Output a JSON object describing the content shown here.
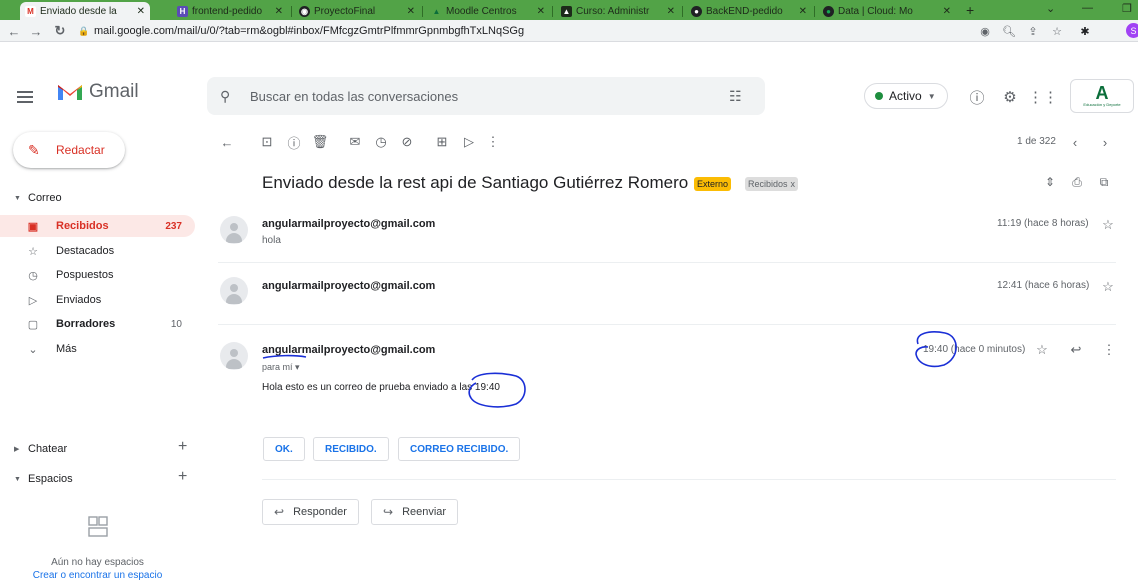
{
  "browser": {
    "tabs": [
      {
        "label": "Enviado desde la",
        "fav": "M",
        "favcolor": "#d93025",
        "favbg": "#ffffff",
        "active": true
      },
      {
        "label": "frontend-pedido",
        "fav": "H",
        "favcolor": "#ffffff",
        "favbg": "#5b4bb7",
        "active": false
      },
      {
        "label": "ProyectoFinal",
        "fav": "◉",
        "favcolor": "#ffffff",
        "favbg": "#202124",
        "active": false
      },
      {
        "label": "Moodle Centros",
        "fav": "▲",
        "favcolor": "#0b6e3a",
        "favbg": "#52a347",
        "active": false
      },
      {
        "label": "Curso: Administr",
        "fav": "▲",
        "favcolor": "#ffffff",
        "favbg": "#1d2a1a",
        "active": false
      },
      {
        "label": "BackEND-pedido",
        "fav": "●",
        "favcolor": "#ffffff",
        "favbg": "#202124",
        "active": false
      },
      {
        "label": "Data | Cloud: Mo",
        "fav": "●",
        "favcolor": "#13aa52",
        "favbg": "#202124",
        "active": false
      }
    ],
    "url": "mail.google.com/mail/u/0/?tab=rm&ogbl#inbox/FMfcgzGmtrPlfmmrGpnmbgfhTxLNqSGg",
    "profile_initial": "S"
  },
  "gmail": {
    "logo_text": "Gmail",
    "search_placeholder": "Buscar en todas las conversaciones",
    "status": "Activo",
    "org_initial": "A",
    "org_sub": "Educación y Deporte"
  },
  "sidebar": {
    "compose_label": "Redactar",
    "mail_section": "Correo",
    "items": [
      {
        "label": "Recibidos",
        "count": "237",
        "icon": "inbox-icon",
        "selected": true,
        "bold": true
      },
      {
        "label": "Destacados",
        "count": "",
        "icon": "star-icon",
        "selected": false,
        "bold": false
      },
      {
        "label": "Pospuestos",
        "count": "",
        "icon": "clock-icon",
        "selected": false,
        "bold": false
      },
      {
        "label": "Enviados",
        "count": "",
        "icon": "send-icon",
        "selected": false,
        "bold": false
      },
      {
        "label": "Borradores",
        "count": "10",
        "icon": "draft-icon",
        "selected": false,
        "bold": true
      },
      {
        "label": "Más",
        "count": "",
        "icon": "chevron-down-icon",
        "selected": false,
        "bold": false
      }
    ],
    "chat_section": "Chatear",
    "spaces_section": "Espacios",
    "no_spaces": "Aún no hay espacios",
    "create_space": "Crear o encontrar un espacio"
  },
  "thread": {
    "page_count": "1 de 322",
    "subject": "Enviado desde la rest api de Santiago Gutiérrez Romero",
    "label_external": "Externo",
    "label_inbox": "Recibidos",
    "messages": [
      {
        "sender": "angularmailproyecto@gmail.com",
        "snippet": "hola",
        "time": "11:19 (hace 8 horas)"
      },
      {
        "sender": "angularmailproyecto@gmail.com",
        "snippet": "",
        "time": "12:41 (hace 6 horas)"
      },
      {
        "sender": "angularmailproyecto@gmail.com",
        "to": "para mí",
        "time": "19:40 (hace 0 minutos)",
        "body": "Hola esto es un correo de prueba enviado a las 19:40"
      }
    ],
    "smart_replies": [
      "OK.",
      "RECIBIDO.",
      "CORREO RECIBIDO."
    ],
    "reply_label": "Responder",
    "forward_label": "Reenviar"
  },
  "colors": {
    "accent_red": "#d93025",
    "selected_bg": "#fce8e6",
    "link_blue": "#1a73e8",
    "annotation_blue": "#1a2fd6",
    "tab_strip": "#52a347"
  }
}
